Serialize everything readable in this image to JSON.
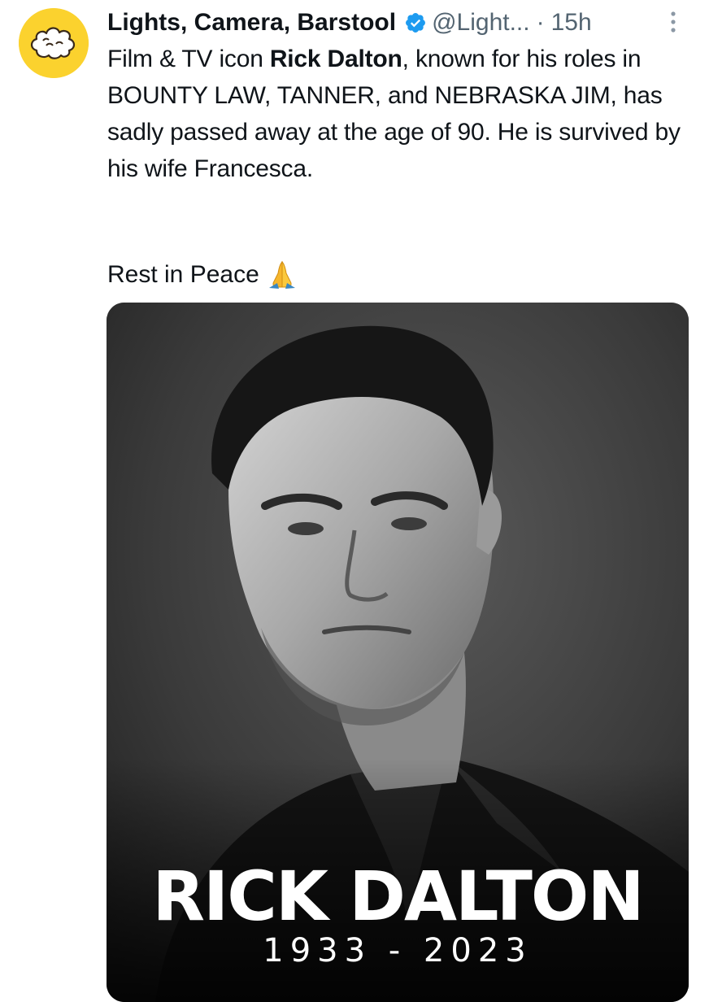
{
  "author": {
    "display_name": "Lights, Camera, Barstool",
    "handle": "@Light...",
    "separator": "·",
    "time": "15h",
    "avatar_icon": "popcorn-icon",
    "verified_icon": "verified-badge-icon"
  },
  "tweet": {
    "text_before": "Film & TV icon ",
    "bold_name": "Rick Dalton",
    "text_after": ", known for his roles in BOUNTY LAW, TANNER, and NEBRASKA JIM, has sadly passed away at the age of 90. He is survived by his wife Francesca.",
    "closing": "Rest in Peace",
    "closing_emoji": "folded-hands-icon"
  },
  "media": {
    "poster_name": "RICK DALTON",
    "poster_years": "1933 - 2023"
  },
  "colors": {
    "text": "#0f1419",
    "secondary": "#536471",
    "verified": "#1d9bf0",
    "avatar_bg": "#fbd22e"
  }
}
